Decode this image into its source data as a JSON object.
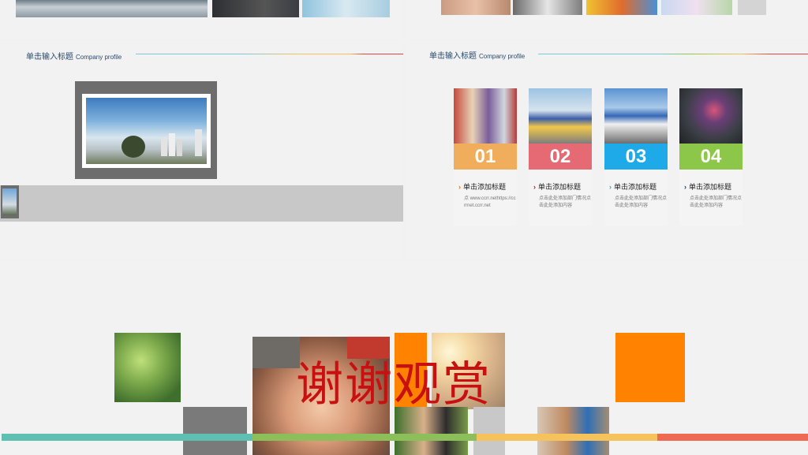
{
  "left_slide": {
    "heading": "单击输入标题",
    "heading_en": "Company profile"
  },
  "right_slide": {
    "heading": "单击输入标题",
    "heading_en": "Company profile",
    "cards": [
      {
        "number": "01",
        "title": "单击添加标题",
        "body": "点 www.ccrr.nethttps://ccrrnet.ccrr.net",
        "color": "#f0ad5b",
        "chevron_color": "#e07a1c"
      },
      {
        "number": "02",
        "title": "单击添加标题",
        "body": "点击此处添加部门情况点击此处添加内容",
        "color": "#e56a74",
        "chevron_color": "#b7192b"
      },
      {
        "number": "03",
        "title": "单击添加标题",
        "body": "点击此处添加部门情况点击此处添加内容",
        "color": "#1ea9e8",
        "chevron_color": "#2ea8a6"
      },
      {
        "number": "04",
        "title": "单击添加标题",
        "body": "点击此处添加部门情况点击此处添加内容",
        "color": "#8cc74a",
        "chevron_color": "#1f3c63"
      }
    ]
  },
  "end_slide": {
    "thanks": "谢谢观赏",
    "stripe_colors": [
      "#5fbfb3",
      "#8cbf5a",
      "#f5c25c",
      "#ee6a55"
    ],
    "accent": "#ff8200"
  }
}
